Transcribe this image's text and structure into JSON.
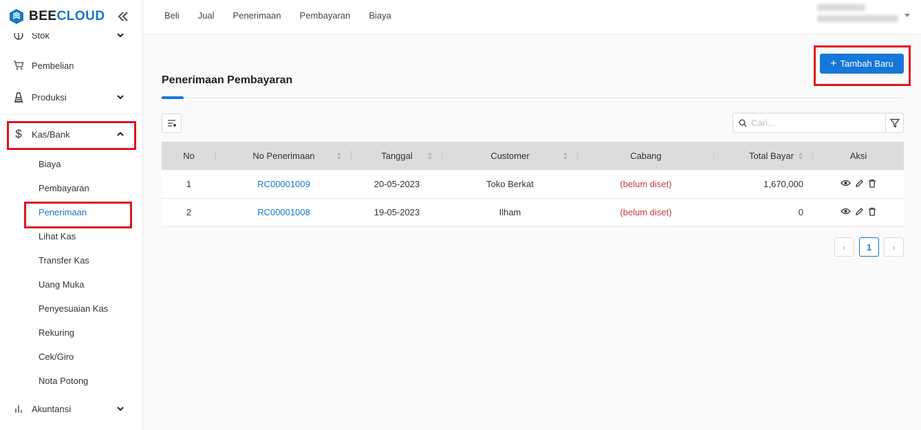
{
  "brand": {
    "part1": "BEE",
    "part2": "CLOUD",
    "color": "#1677c9"
  },
  "sidebar": {
    "items": [
      {
        "label": "Stok"
      },
      {
        "label": "Pembelian"
      },
      {
        "label": "Produksi"
      },
      {
        "label": "Kas/Bank"
      },
      {
        "label": "Akuntansi"
      }
    ],
    "sub_items": [
      {
        "label": "Biaya"
      },
      {
        "label": "Pembayaran"
      },
      {
        "label": "Penerimaan"
      },
      {
        "label": "Lihat Kas"
      },
      {
        "label": "Transfer Kas"
      },
      {
        "label": "Uang Muka"
      },
      {
        "label": "Penyesuaian Kas"
      },
      {
        "label": "Rekuring"
      },
      {
        "label": "Cek/Giro"
      },
      {
        "label": "Nota Potong"
      }
    ]
  },
  "topnav": {
    "links": [
      "Beli",
      "Jual",
      "Penerimaan",
      "Pembayaran",
      "Biaya"
    ]
  },
  "page": {
    "title": "Penerimaan Pembayaran",
    "add_button": "Tambah Baru"
  },
  "search": {
    "placeholder": "Cari..."
  },
  "table": {
    "headers": [
      "No",
      "No Penerimaan",
      "Tanggal",
      "Customer",
      "Cabang",
      "Total Bayar",
      "Aksi"
    ],
    "rows": [
      {
        "no": "1",
        "number": "RC00001009",
        "date": "20-05-2023",
        "customer": "Toko Berkat",
        "branch": "(belum diset)",
        "total": "1,670,000"
      },
      {
        "no": "2",
        "number": "RC00001008",
        "date": "19-05-2023",
        "customer": "Ilham",
        "branch": "(belum diset)",
        "total": "0"
      }
    ]
  },
  "pagination": {
    "current": "1",
    "prev": "‹",
    "next": "›"
  },
  "colors": {
    "accent": "#1677d9",
    "highlight": "#e0141e",
    "unset_text": "#c9393b"
  }
}
